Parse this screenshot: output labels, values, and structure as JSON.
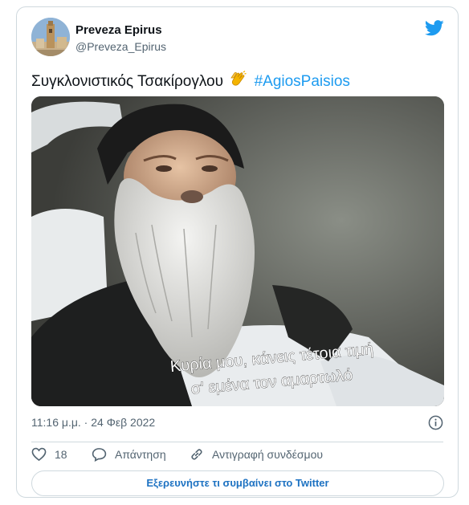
{
  "author": {
    "name": "Preveza Epirus",
    "handle": "@Preveza_Epirus"
  },
  "tweet": {
    "text": "Συγκλονιστικός Τσακίρογλου",
    "emoji_icon": "clapping-hands-icon",
    "hashtag": "#AgiosPaisios"
  },
  "media": {
    "subtitle_line1": "Κυρία μου, κάνεις τέτοια τιμή",
    "subtitle_line2": "σ' εμένα τον αμαρτωλό"
  },
  "meta": {
    "timestamp": "11:16 μ.μ. · 24 Φεβ 2022"
  },
  "actions": {
    "like_count": "18",
    "reply_label": "Απάντηση",
    "copy_link_label": "Αντιγραφή συνδέσμου"
  },
  "explore_label": "Εξερευνήστε τι συμβαίνει στο Twitter",
  "colors": {
    "accent": "#1d9bf0",
    "text": "#0f1419",
    "muted": "#536471",
    "border": "#cfd9de"
  }
}
